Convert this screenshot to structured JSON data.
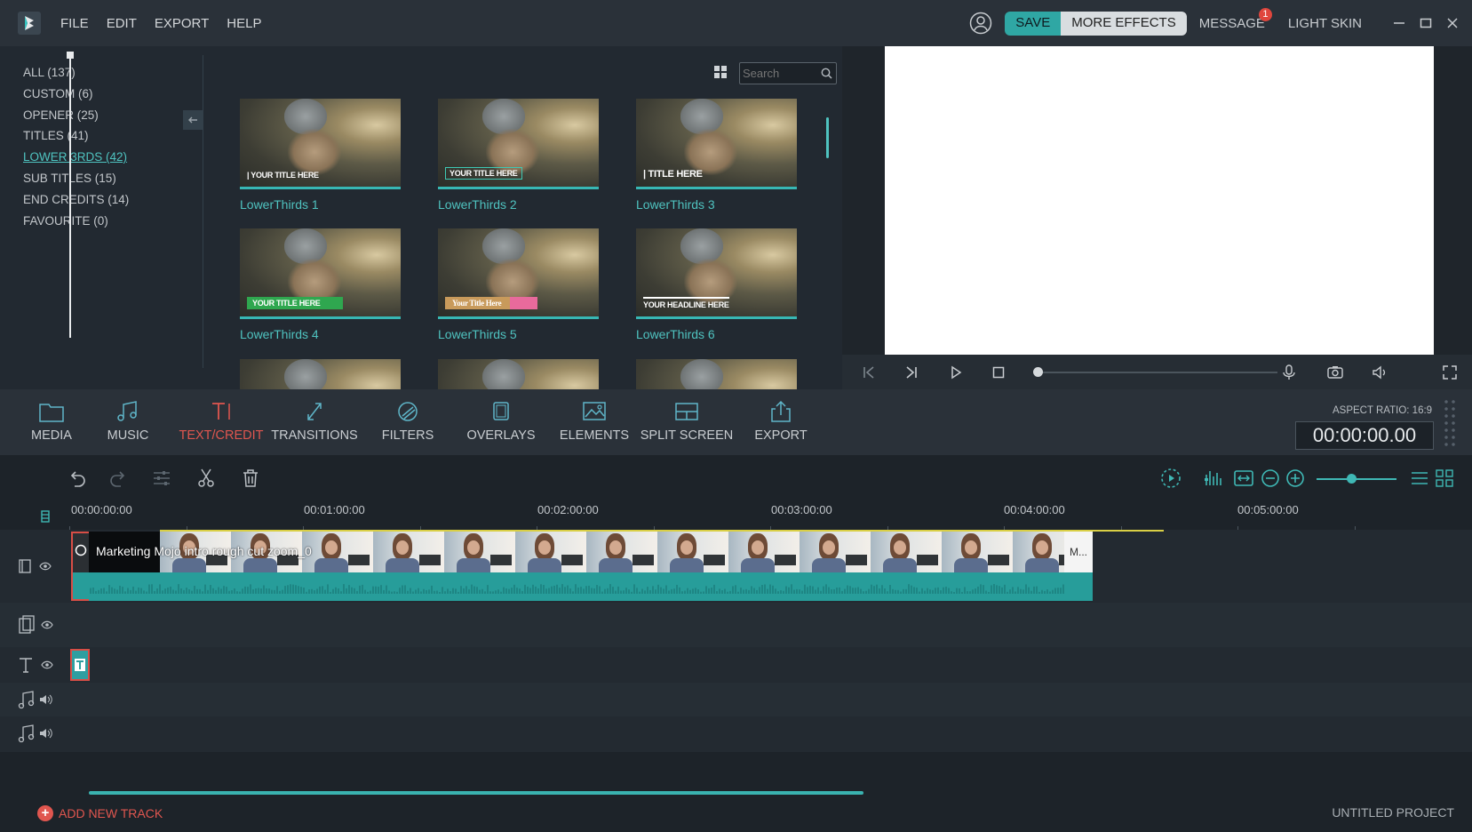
{
  "menu": {
    "file": "FILE",
    "edit": "EDIT",
    "export": "EXPORT",
    "help": "HELP"
  },
  "top_right": {
    "save": "SAVE",
    "more_effects": "MORE EFFECTS",
    "message": "MESSAGE",
    "message_count": "1",
    "light_skin": "LIGHT SKIN"
  },
  "categories": [
    {
      "label": "ALL (137)"
    },
    {
      "label": "CUSTOM (6)"
    },
    {
      "label": "OPENER (25)"
    },
    {
      "label": "TITLES (41)"
    },
    {
      "label": "LOWER 3RDS (42)",
      "active": true
    },
    {
      "label": "SUB TITLES (15)"
    },
    {
      "label": "END CREDITS (14)"
    },
    {
      "label": "FAVOURITE (0)"
    }
  ],
  "search": {
    "placeholder": "Search"
  },
  "effects": [
    {
      "label": "LowerThirds 1",
      "overlay_text": "| YOUR TITLE HERE"
    },
    {
      "label": "LowerThirds 2",
      "overlay_text": "YOUR TITLE HERE"
    },
    {
      "label": "LowerThirds 3",
      "overlay_text": "| TITLE HERE"
    },
    {
      "label": "LowerThirds 4",
      "overlay_text": "YOUR TITLE HERE"
    },
    {
      "label": "LowerThirds 5",
      "overlay_text": "Your Title Here"
    },
    {
      "label": "LowerThirds 6",
      "overlay_text": "YOUR HEADLINE HERE"
    }
  ],
  "toolbar": {
    "media": "MEDIA",
    "music": "MUSIC",
    "text_credit": "TEXT/CREDIT",
    "transitions": "TRANSITIONS",
    "filters": "FILTERS",
    "overlays": "OVERLAYS",
    "elements": "ELEMENTS",
    "split_screen": "SPLIT SCREEN",
    "export": "EXPORT"
  },
  "aspect_ratio": "ASPECT RATIO: 16:9",
  "timecode": "00:00:00.00",
  "ruler": [
    "00:00:00:00",
    "00:01:00:00",
    "00:02:00:00",
    "00:03:00:00",
    "00:04:00:00",
    "00:05:00:00"
  ],
  "clip": {
    "title": "Marketing Mojo intro rough cut zoom_0",
    "end_label": "M..."
  },
  "footer": {
    "add_track": "ADD NEW TRACK",
    "project": "UNTITLED PROJECT"
  },
  "colors": {
    "accent": "#2fa7a4",
    "active_tool": "#e0564f",
    "badge": "#e0463d"
  },
  "icons": {
    "logo": "filmora-logo-icon",
    "user": "user-icon",
    "search": "search-icon"
  }
}
